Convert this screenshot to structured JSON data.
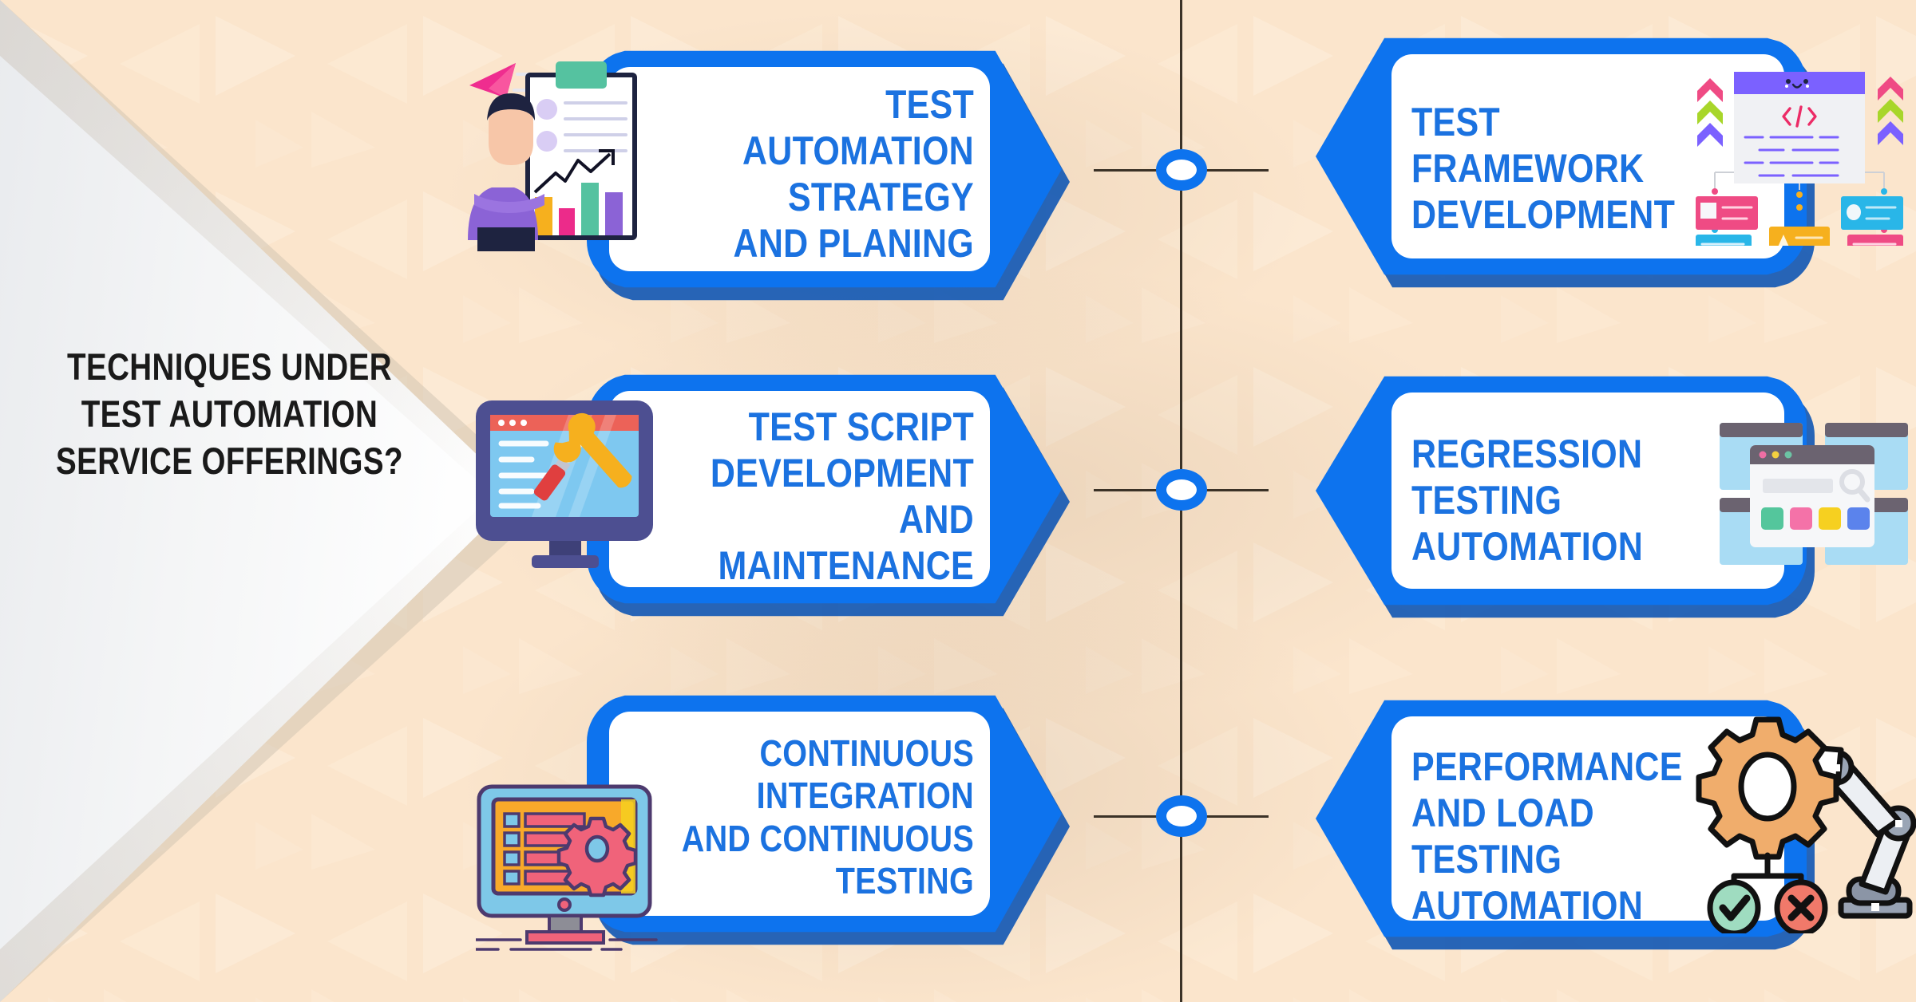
{
  "infographic": {
    "title": "TECHNIQUES UNDER\nTEST AUTOMATION\nSERVICE\nOFFERINGS?",
    "background_color": "#fbe4cb",
    "accent_color": "#0d73ee",
    "text_color": "#1b72e0",
    "title_color": "#1a1a1a",
    "connector_color": "#3b3227"
  },
  "cards": [
    {
      "id": "test-automation-strategy-and-planing",
      "label": "TEST AUTOMATION\nSTRATEGY\nAND PLANING",
      "column": "left",
      "row": 1,
      "icon": "clipboard-chart-person-icon"
    },
    {
      "id": "test-framework-development",
      "label": "TEST FRAMEWORK\nDEVELOPMENT",
      "column": "right",
      "row": 1,
      "icon": "code-window-flowchart-icon"
    },
    {
      "id": "test-script-development-and-maintenance",
      "label": "TEST SCRIPT\nDEVELOPMENT AND\nMAINTENANCE",
      "column": "left",
      "row": 2,
      "icon": "monitor-wrench-screwdriver-icon"
    },
    {
      "id": "regression-testing-automation",
      "label": "REGRESSION TESTING\nAUTOMATION",
      "column": "right",
      "row": 2,
      "icon": "browser-windows-magnifier-icon"
    },
    {
      "id": "continuous-integration-and-continuous-testing",
      "label": "CONTINUOUS INTEGRATION\nAND CONTINUOUS\nTESTING",
      "column": "left",
      "row": 3,
      "icon": "monitor-checklist-gear-icon"
    },
    {
      "id": "performance-and-load-testing-automation",
      "label": "PERFORMANCE\nAND LOAD\nTESTING AUTOMATION",
      "column": "right",
      "row": 3,
      "icon": "gear-robot-arm-pass-fail-icon"
    }
  ],
  "connectors": {
    "node_count": 3,
    "node_fill": "#ffffff",
    "node_ring": "#0d73ee"
  },
  "palette": {
    "card_blue": "#0d73ee",
    "card_blue_shadow": "#1559b4",
    "card_face": "#ffffff",
    "illustration_purple": "#8b63d6",
    "illustration_pink": "#ec2b8a",
    "illustration_green": "#55c2a0",
    "illustration_yellow": "#f6b01e",
    "illustration_orange": "#f0ad6c",
    "illustration_red": "#f0796a",
    "code_header_purple": "#7b61ff",
    "monitor_navy": "#4d4f91",
    "monitor_screen_blue": "#7ec8f0"
  }
}
